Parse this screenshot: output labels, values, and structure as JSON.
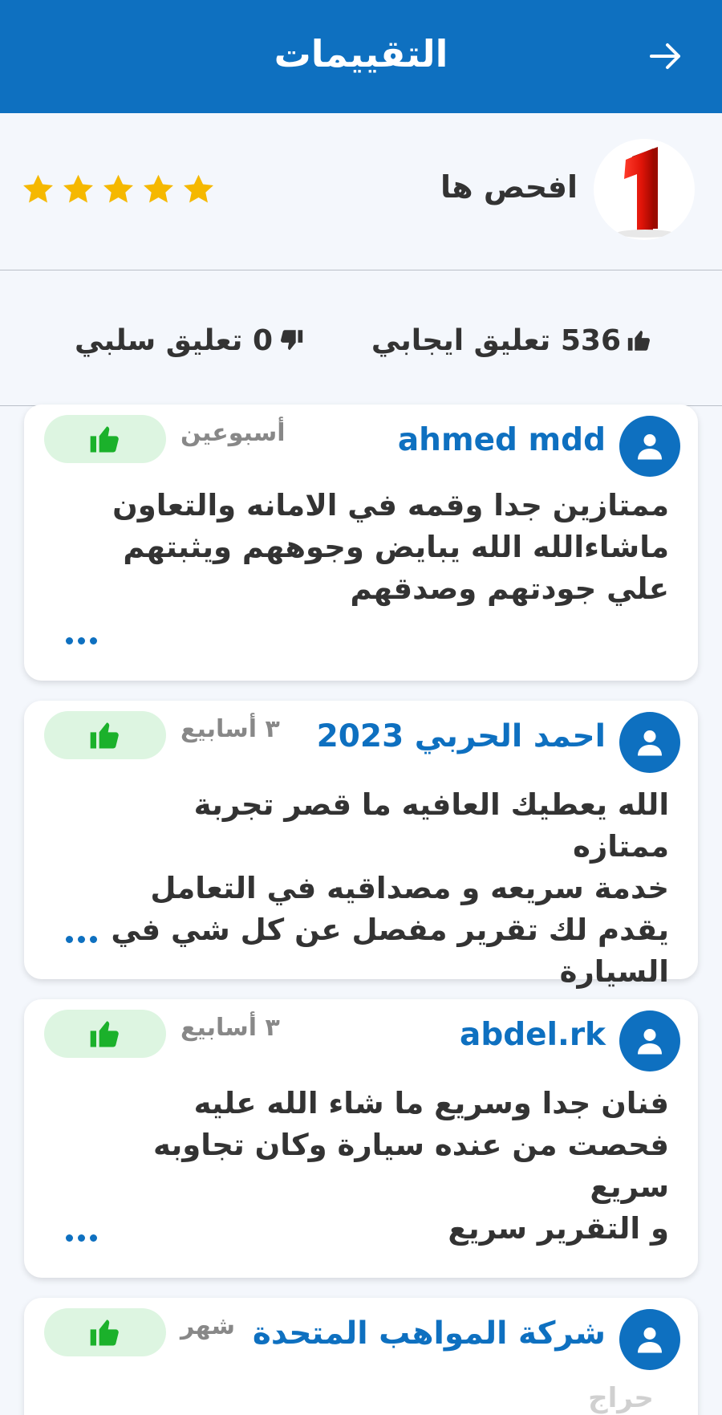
{
  "header": {
    "title": "التقييمات",
    "back_icon": "arrow-right-icon",
    "color": "#0e70c0"
  },
  "business": {
    "name": "افحص ها",
    "logo_text": "1",
    "rating": 5,
    "rating_max": 5,
    "star_color": "#f5b800"
  },
  "counts": {
    "positive_label": "536 تعليق ايجابي",
    "negative_label": "0 تعليق سلبي"
  },
  "reviews": [
    {
      "name": "ahmed mdd",
      "time": "أسبوعين",
      "text": "ممتازين جدا وقمه في الامانه والتعاون\nماشاءالله الله يبايض وجوههم ويثبتهم\nعلي جودتهم وصدقهم",
      "liked": true
    },
    {
      "name": "احمد الحربي 2023",
      "time": "٣ أسابيع",
      "text": "الله يعطيك  العافيه ما قصر تجربة ممتازه\nخدمة سريعه و مصداقيه في التعامل\nيقدم لك تقرير مفصل عن كل شي في\nالسيارة",
      "liked": true
    },
    {
      "name": "abdel.rk",
      "time": "٣ أسابيع",
      "text": "فنان جدا وسريع ما شاء الله عليه\nفحصت من عنده سيارة وكان تجاوبه سريع\nو التقرير سريع",
      "liked": true
    },
    {
      "name": "شركة المواهب المتحدة",
      "time": "شهر",
      "text": "",
      "liked": true
    }
  ],
  "watermark": "حراج"
}
